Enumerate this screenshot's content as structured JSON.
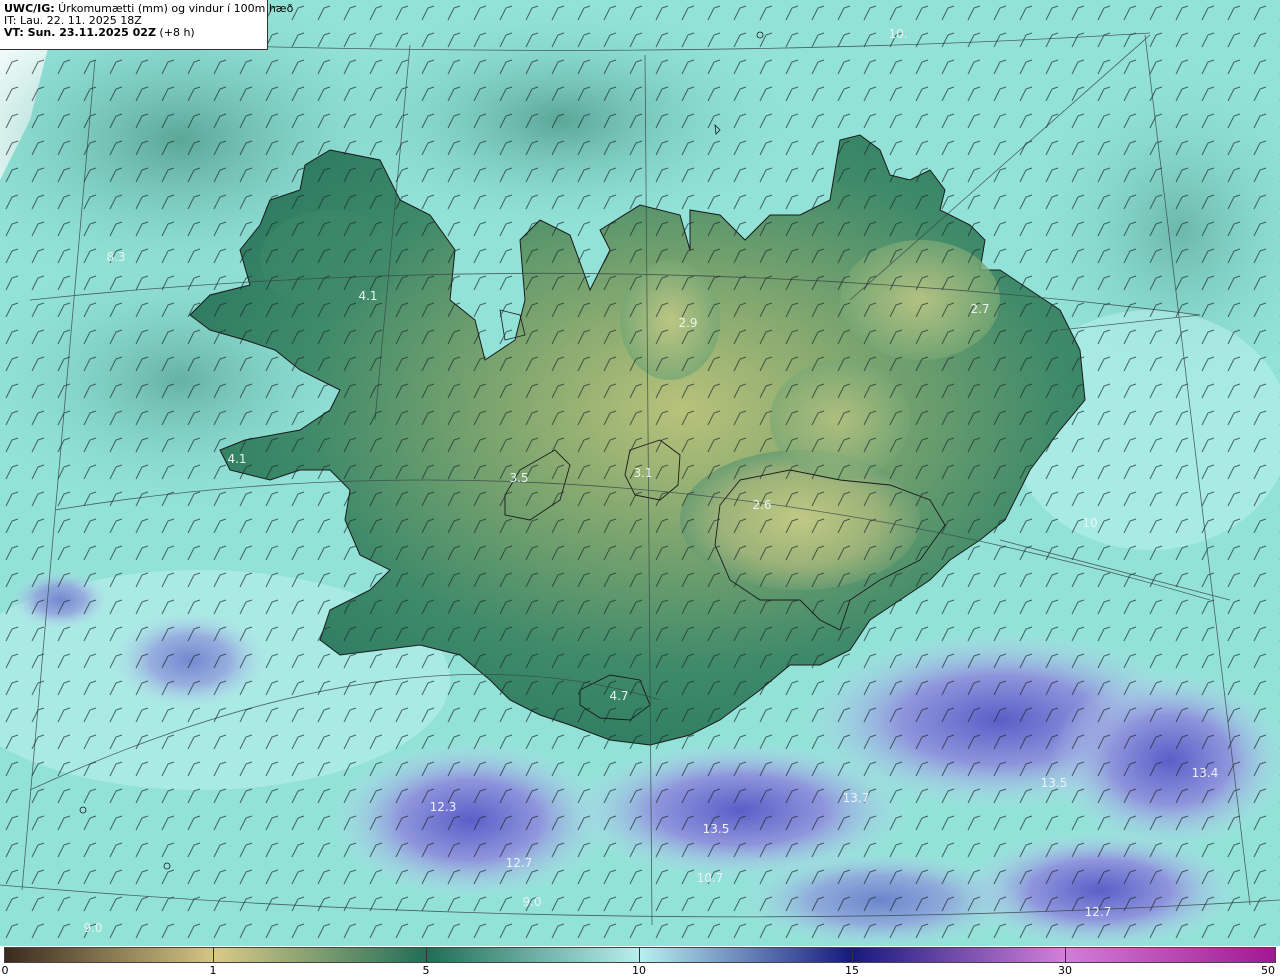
{
  "header": {
    "title_bold": "UWC/IG:",
    "title_rest": " Úrkomumætti (mm) og vindur í 100m hæð",
    "it_line": "IT: Lau. 22. 11. 2025 18Z",
    "vt_bold": "VT: Sun. 23.11.2025 02Z",
    "vt_rest": " (+8 h)"
  },
  "map_values": [
    {
      "text": "8.3",
      "tone": "light"
    },
    {
      "text": "4.1",
      "tone": "light"
    },
    {
      "text": "4.1",
      "tone": "light"
    },
    {
      "text": "3.5",
      "tone": "light"
    },
    {
      "text": "3.1",
      "tone": "light"
    },
    {
      "text": "2.9",
      "tone": "light"
    },
    {
      "text": "2.7",
      "tone": "light"
    },
    {
      "text": "2.6",
      "tone": "light"
    },
    {
      "text": "4.7",
      "tone": "light"
    },
    {
      "text": "10.",
      "tone": "light"
    },
    {
      "text": "10",
      "tone": "light"
    },
    {
      "text": "12.3",
      "tone": "dark"
    },
    {
      "text": "12.7",
      "tone": "dark"
    },
    {
      "text": "13.7",
      "tone": "dark"
    },
    {
      "text": "13.5",
      "tone": "dark"
    },
    {
      "text": "13.5",
      "tone": "dark"
    },
    {
      "text": "13.4",
      "tone": "dark"
    },
    {
      "text": "10.7",
      "tone": "dark"
    },
    {
      "text": "12.7",
      "tone": "dark"
    },
    {
      "text": "9.0",
      "tone": "light"
    },
    {
      "text": "9.0",
      "tone": "light"
    }
  ],
  "colorbar": {
    "ticks": [
      "0",
      "1",
      "5",
      "10",
      "15",
      "30",
      "50"
    ],
    "colors": [
      "#3a2a1e",
      "#d8c887",
      "#1f6e57",
      "#b8f0ef",
      "#17187f",
      "#d080d8",
      "#a01890"
    ]
  }
}
